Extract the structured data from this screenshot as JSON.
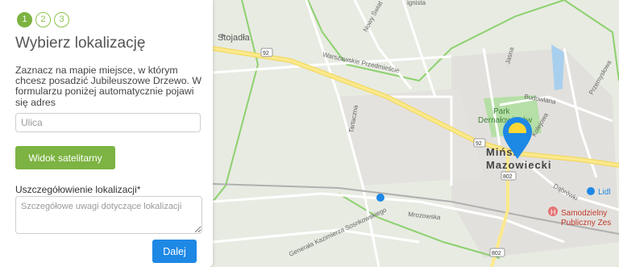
{
  "wizard": {
    "steps": [
      "1",
      "2",
      "3"
    ],
    "active_step": 1,
    "title": "Wybierz lokalizację",
    "description": "Zaznacz na mapie miejsce, w którym chcesz posadzić Jubileuszowe Drzewo. W formularzu poniżej automatycznie pojawi się adres",
    "street_placeholder": "Ulica",
    "satellite_button": "Widok satelitarny",
    "details_label": "Uszczegółowienie lokalizacji*",
    "details_placeholder": "Szczegółowe uwagi dotyczące lokalizacji",
    "next_button": "Dalej"
  },
  "map": {
    "places": {
      "stojadla": "Stojadła",
      "city_line1": "Mińsk",
      "city_line2": "Mazowiecki",
      "park_line1": "Park",
      "park_line2": "Dernałowiczów",
      "hospital_line1": "Samodzielny",
      "hospital_line2": "Publiczny Zes",
      "lidl": "Lidl"
    },
    "streets": {
      "warszawskie": "Warszawskie Przedmieście",
      "nowy_swiat": "Nowy Świat",
      "tartaczna": "Tartaczna",
      "mrozowska": "Mrozowska",
      "sosnkowskiego": "Generała Kazimierza Sosnkowskiego",
      "budowlana": "Budowlana",
      "kolejowa": "Kolejowa",
      "jasna": "Jasna",
      "dabrowki": "Dąbrówki",
      "przemyslowa": "Przemysłowa",
      "ignista": "ignista"
    },
    "road_badges": {
      "r92a": "92",
      "r92b": "92",
      "r802": "802"
    },
    "colors": {
      "marker": "#1e88e5",
      "marker_inner": "#fdd835",
      "road": "#f7e37a",
      "park": "#b5dfa6",
      "boundary": "#8dd16f",
      "water": "#a9cfee"
    }
  }
}
